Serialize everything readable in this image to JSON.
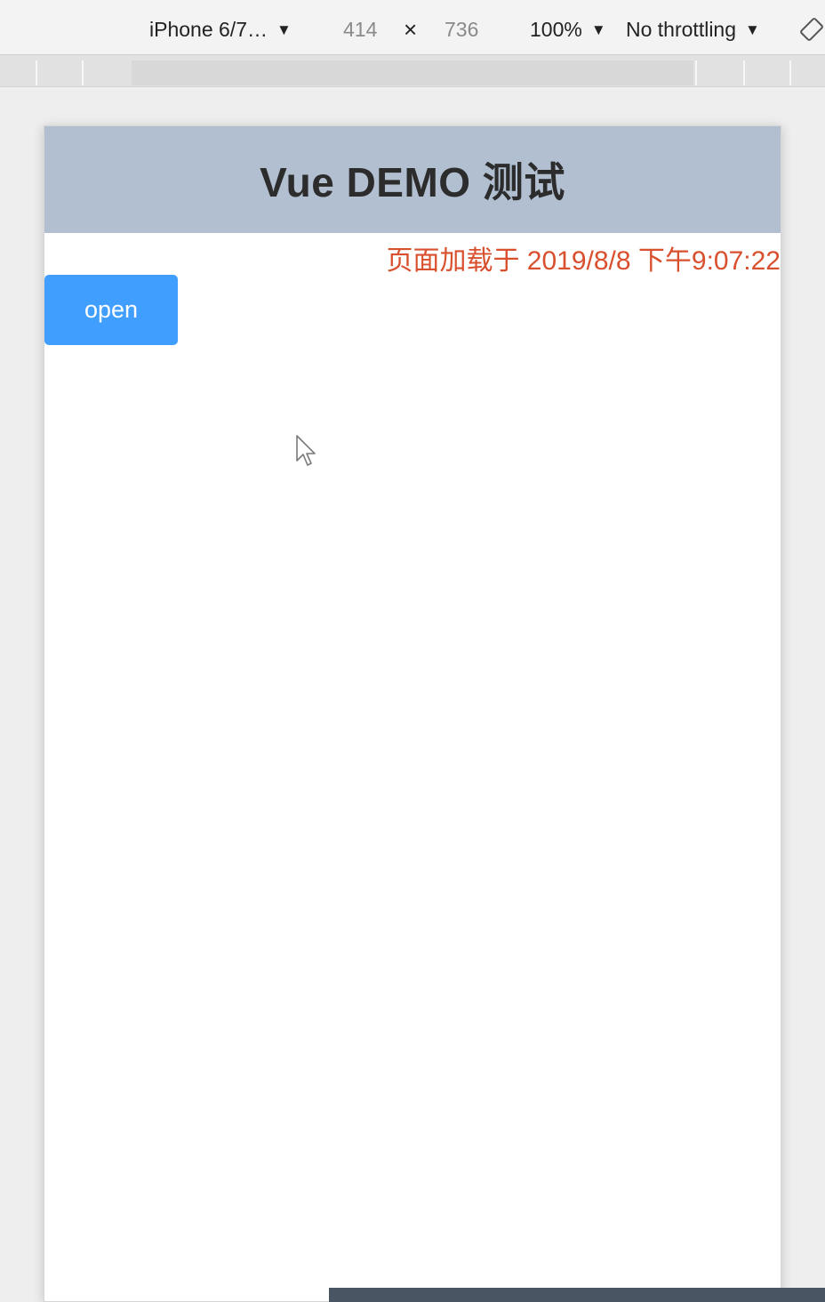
{
  "devtools": {
    "device": "iPhone 6/7…",
    "width": "414",
    "times": "×",
    "height": "736",
    "zoom": "100%",
    "throttling": "No throttling",
    "caret": "▼"
  },
  "app": {
    "title": "Vue DEMO 测试",
    "load_time": "页面加载于 2019/8/8 下午9:07:22",
    "open_label": "open"
  },
  "colors": {
    "header_bg": "#b1bfd1",
    "load_time_text": "#d9502e",
    "button_bg": "#409eff"
  },
  "icons": {
    "rotate": "rotate-icon",
    "cursor": "mouse-cursor-icon"
  }
}
